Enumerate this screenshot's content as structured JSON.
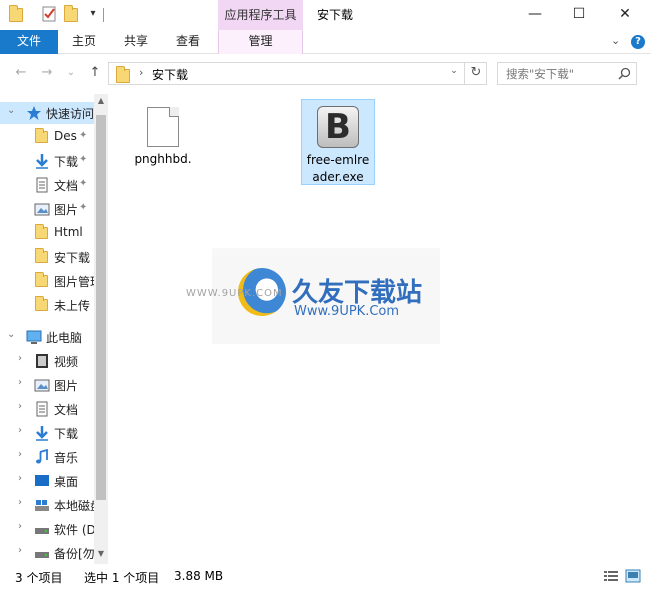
{
  "window": {
    "contextual_tab": "应用程序工具",
    "title": "安下载",
    "minimize": "—",
    "maximize": "☐",
    "close": "✕"
  },
  "ribbon": {
    "tabs": [
      "文件",
      "主页",
      "共享",
      "查看",
      "管理"
    ],
    "expand_glyph": "⌄"
  },
  "nav": {
    "back": "←",
    "forward": "→",
    "dropdown": "⌄",
    "up": "↑",
    "breadcrumb_sep": "›",
    "address": "安下载",
    "refresh": "↻",
    "search_placeholder": "搜索\"安下载\""
  },
  "sidebar": {
    "quick_access": "快速访问",
    "quick_items": [
      {
        "label": "Des",
        "pinned": true,
        "icon": "folder-icon"
      },
      {
        "label": "下载",
        "pinned": true,
        "icon": "download-icon"
      },
      {
        "label": "文档",
        "pinned": true,
        "icon": "document-icon"
      },
      {
        "label": "图片",
        "pinned": true,
        "icon": "picture-icon"
      },
      {
        "label": "Html",
        "pinned": false,
        "icon": "folder-icon"
      },
      {
        "label": "安下载",
        "pinned": false,
        "icon": "folder-icon"
      },
      {
        "label": "图片管理",
        "pinned": false,
        "icon": "folder-icon"
      },
      {
        "label": "未上传",
        "pinned": false,
        "icon": "folder-icon"
      }
    ],
    "this_pc": "此电脑",
    "pc_items": [
      {
        "label": "视频",
        "icon": "video-icon"
      },
      {
        "label": "图片",
        "icon": "picture-icon"
      },
      {
        "label": "文档",
        "icon": "document-icon"
      },
      {
        "label": "下载",
        "icon": "download-icon"
      },
      {
        "label": "音乐",
        "icon": "music-icon"
      },
      {
        "label": "桌面",
        "icon": "desktop-icon"
      },
      {
        "label": "本地磁盘",
        "icon": "drive-icon"
      },
      {
        "label": "软件 (D",
        "icon": "drive-icon"
      },
      {
        "label": "备份[勿",
        "icon": "drive-icon"
      }
    ],
    "pin_glyph": "📌",
    "chev_down": "⌄",
    "chev_right": "›"
  },
  "files": [
    {
      "name": "pnghhbd.",
      "type": "document",
      "selected": false
    },
    {
      "name": "free-emlreader.exe",
      "type": "exe",
      "selected": true,
      "icon_letter": "B"
    }
  ],
  "watermark": {
    "left_text": "WWW.9UPK.COM",
    "brand": "久友下载站",
    "url": "Www.9UPK.Com"
  },
  "status": {
    "item_count": "3 个项目",
    "selection": "选中 1 个项目",
    "size": "3.88 MB"
  },
  "colors": {
    "file_tab": "#1979ca",
    "contextual": "#f2d7f5",
    "selection": "#cce8ff",
    "folder": "#f8d775"
  }
}
